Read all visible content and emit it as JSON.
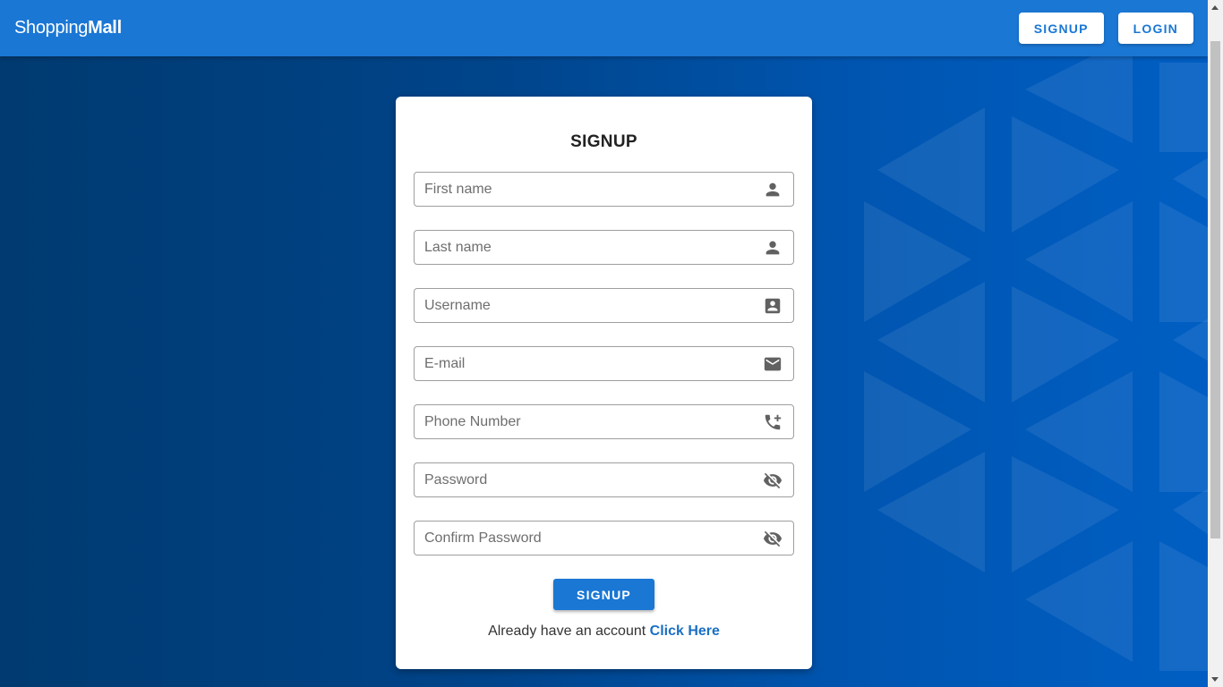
{
  "brand": {
    "light": "Shopping",
    "bold": "Mall"
  },
  "nav": {
    "signup_label": "SIGNUP",
    "login_label": "LOGIN"
  },
  "form": {
    "title": "SIGNUP",
    "fields": [
      {
        "placeholder": "First name",
        "value": "",
        "icon": "person-icon"
      },
      {
        "placeholder": "Last name",
        "value": "",
        "icon": "person-icon"
      },
      {
        "placeholder": "Username",
        "value": "",
        "icon": "account-box-icon"
      },
      {
        "placeholder": "E-mail",
        "value": "",
        "icon": "mail-icon"
      },
      {
        "placeholder": "Phone Number",
        "value": "",
        "icon": "phone-add-icon"
      },
      {
        "placeholder": "Password",
        "value": "",
        "icon": "eye-off-icon"
      },
      {
        "placeholder": "Confirm Password",
        "value": "",
        "icon": "eye-off-icon"
      }
    ],
    "submit_label": "SIGNUP",
    "footer_text": "Already have an account ",
    "footer_link": "Click Here"
  },
  "colors": {
    "appbar": "#1a77d4",
    "accent": "#1a77d4",
    "background": "#004a94",
    "link": "#1a6fc4"
  }
}
